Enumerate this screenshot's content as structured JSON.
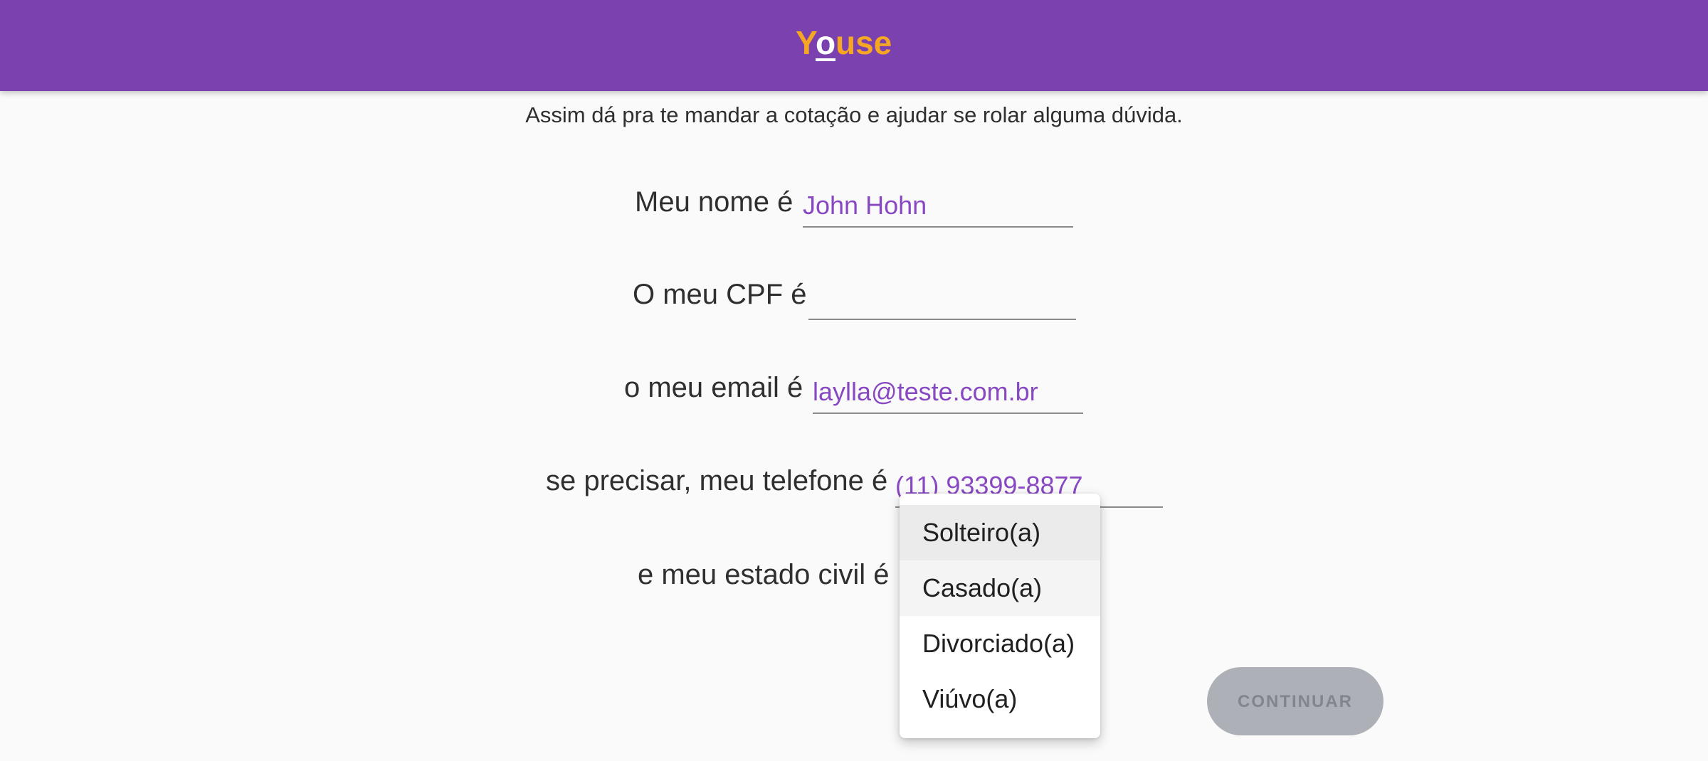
{
  "header": {
    "logo_text": "YOUSE",
    "colors": {
      "background": "#7b42af",
      "logo": "#f6a623",
      "logo_o": "#ffffff"
    }
  },
  "intro": {
    "subtitle": "Assim dá pra te mandar a cotação e ajudar se rolar alguma dúvida."
  },
  "form": {
    "name": {
      "label": "Meu nome é",
      "value": "John Hohn"
    },
    "cpf": {
      "label": "O meu CPF é",
      "value": ""
    },
    "email": {
      "label": "o meu email é",
      "value": "laylla@teste.com.br"
    },
    "phone": {
      "label": "se precisar, meu telefone é",
      "value": "(11) 93399-8877"
    },
    "marital_status": {
      "label": "e meu estado civil é",
      "options": [
        "Solteiro(a)",
        "Casado(a)",
        "Divorciado(a)",
        "Viúvo(a)"
      ],
      "highlighted": "Solteiro(a)"
    }
  },
  "actions": {
    "continue_label": "CONTINUAR"
  },
  "colors": {
    "accent": "#8848c2",
    "button_disabled_bg": "#adb0b6",
    "button_disabled_text": "#82858c"
  }
}
